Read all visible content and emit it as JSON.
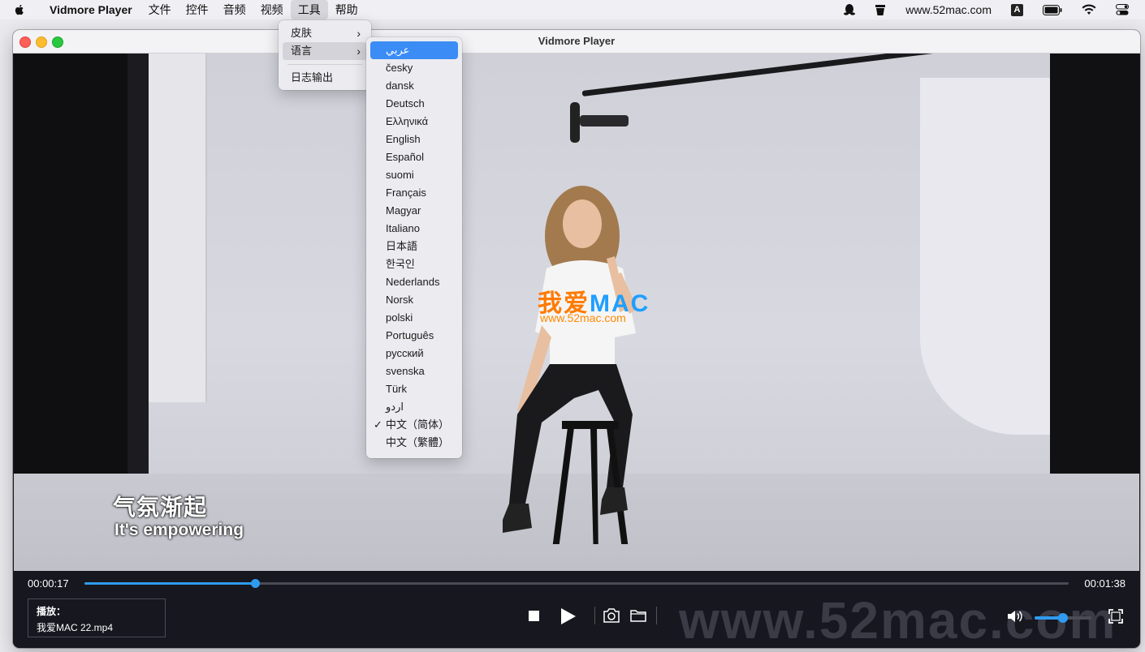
{
  "menubar": {
    "app_name": "Vidmore Player",
    "items": [
      "文件",
      "控件",
      "音频",
      "视频",
      "工具",
      "帮助"
    ],
    "active_item": "工具",
    "status_site": "www.52mac.com",
    "input_indicator": "A"
  },
  "window": {
    "title": "Vidmore Player"
  },
  "tools_menu": {
    "items": [
      {
        "label": "皮肤",
        "submenu": true
      },
      {
        "label": "语言",
        "submenu": true,
        "highlighted": true
      },
      {
        "label": "日志输出",
        "submenu": false
      }
    ]
  },
  "language_menu": {
    "items": [
      {
        "label": "عربي",
        "highlighted": true
      },
      {
        "label": "česky"
      },
      {
        "label": "dansk"
      },
      {
        "label": "Deutsch"
      },
      {
        "label": "Ελληνικά"
      },
      {
        "label": "English"
      },
      {
        "label": "Español"
      },
      {
        "label": "suomi"
      },
      {
        "label": "Français"
      },
      {
        "label": "Magyar"
      },
      {
        "label": "Italiano"
      },
      {
        "label": "日本語"
      },
      {
        "label": "한국인"
      },
      {
        "label": "Nederlands"
      },
      {
        "label": "Norsk"
      },
      {
        "label": "polski"
      },
      {
        "label": "Português"
      },
      {
        "label": "русский"
      },
      {
        "label": "svenska"
      },
      {
        "label": "Türk"
      },
      {
        "label": "اردو"
      },
      {
        "label": "中文（简体）",
        "checked": true
      },
      {
        "label": "中文（繁體）"
      }
    ],
    "check_mark": "✓"
  },
  "video": {
    "subtitle_cn": "气氛渐起",
    "subtitle_en": "It's empowering",
    "watermark_cn": "我爱",
    "watermark_mac": "MAC",
    "watermark_url": "www.52mac.com"
  },
  "player": {
    "current_time": "00:00:17",
    "total_time": "00:01:38",
    "progress_fraction": 0.173,
    "now_playing_label": "播放：",
    "now_playing_file": "我爱MAC 22.mp4",
    "volume_fraction": 0.5,
    "bottom_watermark": "www.52mac.com"
  },
  "colors": {
    "accent": "#2f9bf0",
    "menu_highlight": "#3b8cf5",
    "player_bg": "#16171f"
  }
}
